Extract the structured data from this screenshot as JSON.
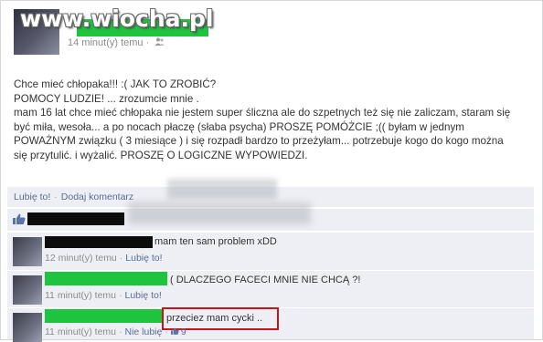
{
  "watermark": "www.wiocha.pl",
  "post": {
    "timestamp": "14 minut(y) temu",
    "lines": [
      "Chce mieć chłopaka!!! :( JAK TO ZROBIĆ?",
      "POMOCY LUDZIE! ... zrozumcie mnie .",
      "mam 16 lat chce mieć chłopaka nie jestem super śliczna ale do szpetnych też się nie zaliczam, staram się",
      "być miła, wesoła... a po nocach płaczę (słaba psycha) PROSZĘ POMÓŻCIE ;(( byłam w jednym",
      "POWAŻNYM związku ( 3 miesiące ) i się rozpadł bardzo to przeżyłam... potrzebuje kogo do kogo można",
      "się przytulić. i wyżalić. PROSZĘ O LOGICZNE WYPOWIEDZI."
    ],
    "like_label": "Lubię to!",
    "comment_label": "Dodaj komentarz"
  },
  "comments": [
    {
      "text": "mam ten sam problem xDD",
      "timestamp": "12 minut(y) temu",
      "like_label": "Lubię to!"
    },
    {
      "text": "( DLACZEGO FACECI MNIE NIE CHCĄ ?!",
      "timestamp": "11 minut(y) temu",
      "like_label": "Lubię to!"
    },
    {
      "text": "przeciez mam cycki ..",
      "timestamp": "11 minut(y) temu",
      "like_label": "Nie lubię",
      "like_count": "9"
    }
  ],
  "colors": {
    "redaction_green": "#1ec33e",
    "redaction_black": "#0c0c0c",
    "link_blue": "#5a6d96",
    "highlight_red": "#c4161c"
  }
}
